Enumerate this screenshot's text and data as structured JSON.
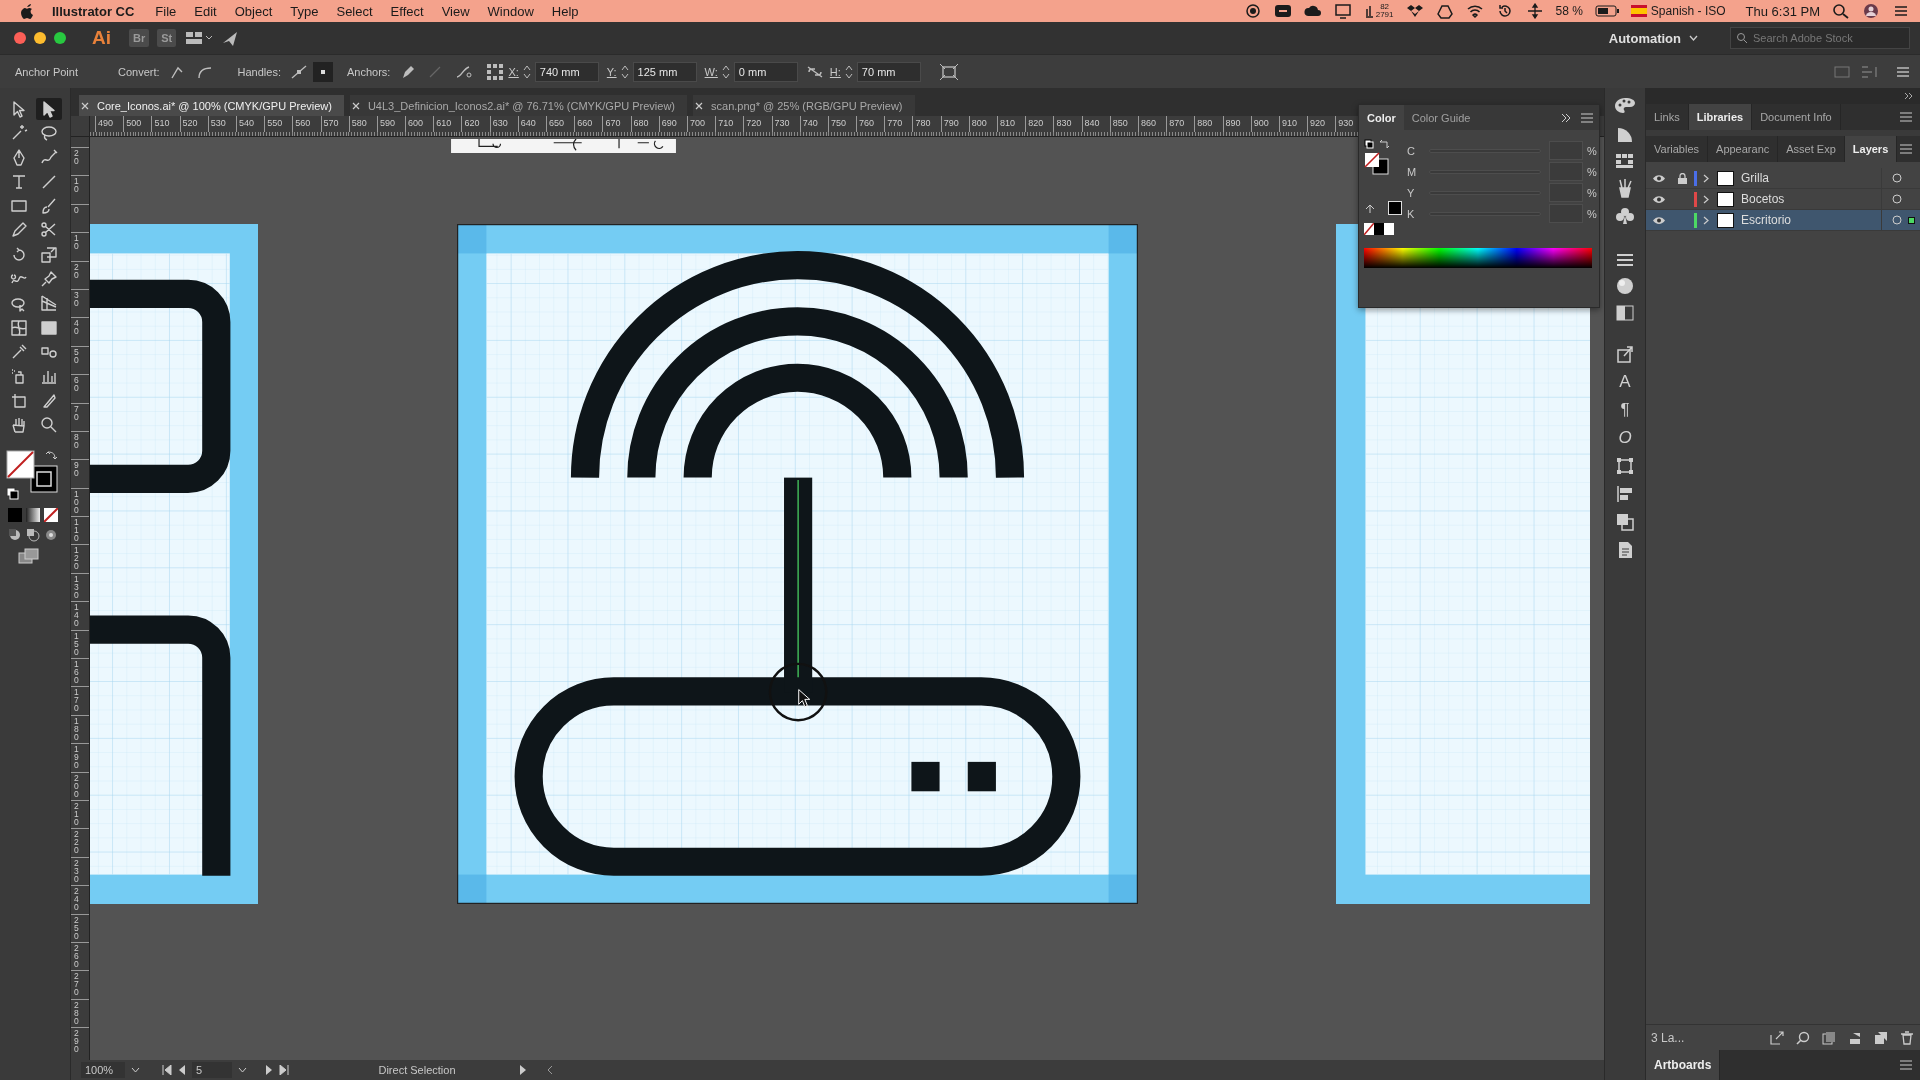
{
  "menu_bar": {
    "app": "Illustrator CC",
    "items": [
      "File",
      "Edit",
      "Object",
      "Type",
      "Select",
      "Effect",
      "View",
      "Window",
      "Help"
    ],
    "status": {
      "counts": [
        "82",
        "2791"
      ],
      "battery": "58 %",
      "input_source": "Spanish - ISO",
      "clock": "Thu 6:31 PM"
    }
  },
  "app_bar": {
    "logo": "Ai",
    "apps": [
      "Br",
      "St"
    ],
    "workspace": "Automation",
    "search": {
      "placeholder": "Search Adobe Stock"
    }
  },
  "control_bar": {
    "selection": "Anchor Point",
    "convert_label": "Convert:",
    "handles_label": "Handles:",
    "anchors_label": "Anchors:",
    "fields": [
      {
        "label": "X:",
        "value": "740 mm"
      },
      {
        "label": "Y:",
        "value": "125 mm"
      },
      {
        "label": "W:",
        "value": "0 mm"
      },
      {
        "label": "H:",
        "value": "70 mm"
      }
    ]
  },
  "document_tabs": [
    {
      "label": "Core_Iconos.ai* @ 100% (CMYK/GPU Preview)",
      "selected": true
    },
    {
      "label": "U4L3_Definicion_Iconos2.ai* @ 76.71% (CMYK/GPU Preview)",
      "selected": false
    },
    {
      "label": "scan.png* @ 25% (RGB/GPU Preview)",
      "selected": false
    }
  ],
  "rulers": {
    "horizontal": [
      "490",
      "500",
      "510",
      "520",
      "530",
      "540",
      "550",
      "560",
      "570",
      "580",
      "590",
      "600",
      "610",
      "620",
      "630",
      "640",
      "650",
      "660",
      "670",
      "680",
      "690",
      "700",
      "710",
      "720",
      "730",
      "740",
      "750",
      "760",
      "770",
      "780",
      "790",
      "800",
      "810",
      "820",
      "830",
      "840",
      "850",
      "860",
      "870",
      "880",
      "890",
      "900",
      "910",
      "920",
      "930"
    ],
    "vertical": [
      "20",
      "10",
      "0",
      "10",
      "20",
      "30",
      "40",
      "50",
      "60",
      "70",
      "80",
      "90",
      "100",
      "110",
      "120",
      "130",
      "140",
      "150",
      "160",
      "170",
      "180",
      "190",
      "200",
      "210",
      "220",
      "230",
      "240",
      "250",
      "260",
      "270",
      "280",
      "290"
    ]
  },
  "tools": [
    {
      "kind": "selection",
      "selected": false
    },
    {
      "kind": "direct-selection",
      "selected": true
    },
    {
      "kind": "magic-wand",
      "selected": false
    },
    {
      "kind": "lasso",
      "selected": false
    },
    {
      "kind": "pen",
      "selected": false
    },
    {
      "kind": "curvature",
      "selected": false
    },
    {
      "kind": "type",
      "selected": false
    },
    {
      "kind": "line",
      "selected": false
    },
    {
      "kind": "rectangle",
      "selected": false
    },
    {
      "kind": "paintbrush",
      "selected": false
    },
    {
      "kind": "pencil",
      "selected": false
    },
    {
      "kind": "scissors",
      "selected": false
    },
    {
      "kind": "rotate",
      "selected": false
    },
    {
      "kind": "scale",
      "selected": false
    },
    {
      "kind": "warp",
      "selected": false
    },
    {
      "kind": "pin",
      "selected": false
    },
    {
      "kind": "shape-builder",
      "selected": false
    },
    {
      "kind": "perspective-grid",
      "selected": false
    },
    {
      "kind": "mesh",
      "selected": false
    },
    {
      "kind": "gradient",
      "selected": false
    },
    {
      "kind": "eyedropper",
      "selected": false
    },
    {
      "kind": "blend",
      "selected": false
    },
    {
      "kind": "symbol-sprayer",
      "selected": false
    },
    {
      "kind": "graph",
      "selected": false
    },
    {
      "kind": "artboard",
      "selected": false
    },
    {
      "kind": "knife",
      "selected": false
    },
    {
      "kind": "hand",
      "selected": false
    },
    {
      "kind": "zoom",
      "selected": false
    }
  ],
  "color_panel": {
    "tabs": [
      {
        "label": "Color",
        "selected": true
      },
      {
        "label": "Color Guide",
        "selected": false
      }
    ],
    "channels": [
      {
        "name": "C",
        "unit": "%",
        "disabled": true
      },
      {
        "name": "M",
        "unit": "%",
        "disabled": true
      },
      {
        "name": "Y",
        "unit": "%",
        "disabled": true
      },
      {
        "name": "K",
        "unit": "%",
        "disabled": true
      }
    ]
  },
  "dock_glyphs": [
    "A",
    "¶",
    "O"
  ],
  "panel_tabs_top": [
    {
      "label": "Links",
      "selected": false
    },
    {
      "label": "Libraries",
      "selected": true
    },
    {
      "label": "Document Info",
      "selected": false
    }
  ],
  "panel_tabs": [
    {
      "label": "Variables",
      "selected": false
    },
    {
      "label": "Appearanc",
      "selected": false
    },
    {
      "label": "Asset Exp",
      "selected": false
    },
    {
      "label": "Layers",
      "selected": true
    }
  ],
  "layers": [
    {
      "name": "Grilla",
      "color": "#4a6ee8",
      "visible": true,
      "locked": true,
      "selected": false,
      "has_selected_art": false
    },
    {
      "name": "Bocetos",
      "color": "#e04848",
      "visible": true,
      "locked": false,
      "selected": false,
      "has_selected_art": false
    },
    {
      "name": "Escritorio",
      "color": "#4cd964",
      "visible": true,
      "locked": false,
      "selected": true,
      "has_selected_art": true
    }
  ],
  "layers_footer": "3 La...",
  "artboards_panel": {
    "title": "Artboards"
  },
  "status_bar": {
    "zoom": "100%",
    "artboard": "5",
    "tool": "Direct Selection"
  }
}
